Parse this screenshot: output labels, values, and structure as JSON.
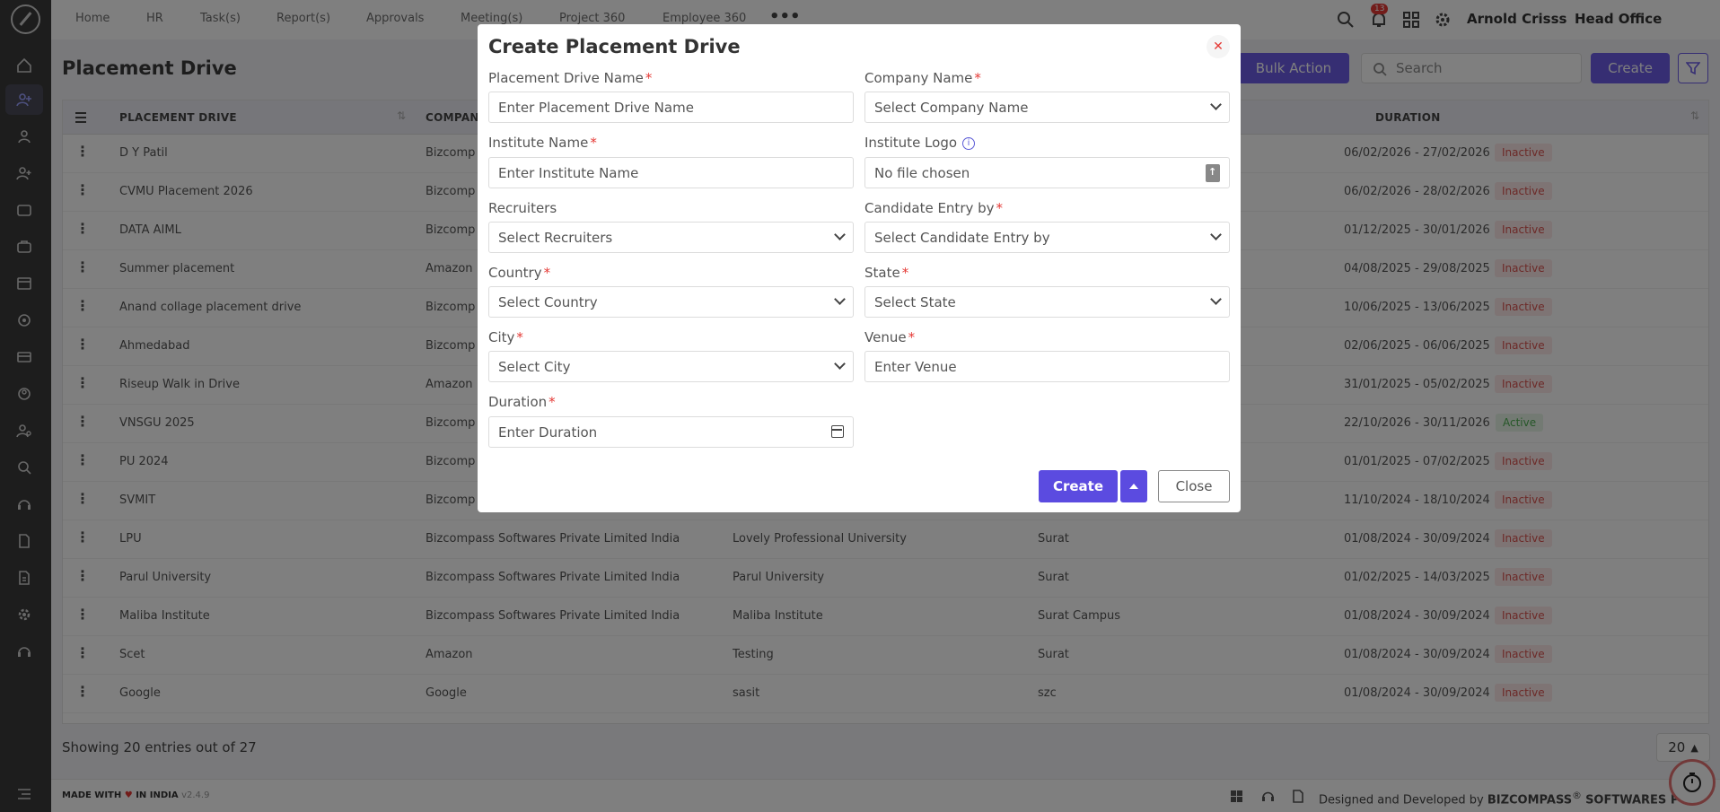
{
  "nav": {
    "items": [
      "Home",
      "HR",
      "Task(s)",
      "Report(s)",
      "Approvals",
      "Meeting(s)",
      "Project 360",
      "Employee 360"
    ],
    "notification_count": "13",
    "user_name": "Arnold Crisss",
    "office": "Head Office"
  },
  "page": {
    "title": "Placement Drive",
    "bulk_action": "Bulk Action",
    "search_placeholder": "Search",
    "create_label": "Create"
  },
  "table": {
    "headers": [
      "PLACEMENT DRIVE",
      "COMPAN",
      "DURATION"
    ],
    "rows": [
      {
        "name": "D Y Patil",
        "company": "Bizcomp",
        "institute": "",
        "venue": "",
        "duration": "06/02/2026 - 27/02/2026",
        "status": "Inactive"
      },
      {
        "name": "CVMU Placement 2026",
        "company": "Bizcomp",
        "institute": "",
        "venue": "",
        "duration": "06/02/2026 - 28/02/2026",
        "status": "Inactive"
      },
      {
        "name": "DATA AIML",
        "company": "Bizcomp",
        "institute": "",
        "venue": "",
        "duration": "01/12/2025 - 30/01/2026",
        "status": "Inactive"
      },
      {
        "name": "Summer placement",
        "company": "Amazon",
        "institute": "",
        "venue": "",
        "duration": "04/08/2025 - 29/08/2025",
        "status": "Inactive"
      },
      {
        "name": "Anand collage placement drive",
        "company": "Bizcomp",
        "institute": "",
        "venue": "",
        "duration": "10/06/2025 - 13/06/2025",
        "status": "Inactive"
      },
      {
        "name": "Ahmedabad",
        "company": "Bizcomp",
        "institute": "",
        "venue": "",
        "duration": "02/06/2025 - 06/06/2025",
        "status": "Inactive"
      },
      {
        "name": "Riseup Walk in Drive",
        "company": "Amazon",
        "institute": "",
        "venue": "",
        "duration": "31/01/2025 - 05/02/2025",
        "status": "Inactive"
      },
      {
        "name": "VNSGU 2025",
        "company": "Bizcomp",
        "institute": "",
        "venue": "",
        "duration": "22/10/2026 - 30/11/2026",
        "status": "Active"
      },
      {
        "name": "PU 2024",
        "company": "Bizcomp",
        "institute": "",
        "venue": "",
        "duration": "01/01/2025 - 07/02/2025",
        "status": "Inactive"
      },
      {
        "name": "SVMIT",
        "company": "Bizcomp",
        "institute": "",
        "venue": "",
        "duration": "11/10/2024 - 18/10/2024",
        "status": "Inactive"
      },
      {
        "name": "LPU",
        "company": "Bizcompass Softwares Private Limited India",
        "institute": "Lovely Professional University",
        "venue": "Surat",
        "duration": "01/08/2024 - 30/09/2024",
        "status": "Inactive"
      },
      {
        "name": "Parul University",
        "company": "Bizcompass Softwares Private Limited India",
        "institute": "Parul University",
        "venue": "Surat",
        "duration": "01/02/2025 - 14/03/2025",
        "status": "Inactive"
      },
      {
        "name": "Maliba Institute",
        "company": "Bizcompass Softwares Private Limited India",
        "institute": "Maliba Institute",
        "venue": "Surat Campus",
        "duration": "01/08/2024 - 30/09/2024",
        "status": "Inactive"
      },
      {
        "name": "Scet",
        "company": "Amazon",
        "institute": "Testing",
        "venue": "Surat",
        "duration": "01/08/2024 - 30/09/2024",
        "status": "Inactive"
      },
      {
        "name": "Google",
        "company": "Google",
        "institute": "sasit",
        "venue": "szc",
        "duration": "01/08/2024 - 30/09/2024",
        "status": "Inactive"
      }
    ]
  },
  "pagination": {
    "showing": "Showing 20 entries out of 27",
    "page_size": "20"
  },
  "footer": {
    "made_with": "MADE WITH",
    "in_india": "IN INDIA",
    "version": "v2.4.9",
    "designed": "Designed and Developed by",
    "company": "BIZCOMPASS",
    "company_suffix": "SOFTWARES PV"
  },
  "modal": {
    "title": "Create Placement Drive",
    "fields": {
      "drive_name_label": "Placement Drive Name",
      "drive_name_placeholder": "Enter Placement Drive Name",
      "company_label": "Company Name",
      "company_value": "Select Company Name",
      "institute_label": "Institute Name",
      "institute_placeholder": "Enter Institute Name",
      "logo_label": "Institute Logo",
      "logo_value": "No file chosen",
      "recruiters_label": "Recruiters",
      "recruiters_value": "Select Recruiters",
      "candidate_label": "Candidate Entry by",
      "candidate_value": "Select Candidate Entry by",
      "country_label": "Country",
      "country_value": "Select Country",
      "state_label": "State",
      "state_value": "Select State",
      "city_label": "City",
      "city_value": "Select City",
      "venue_label": "Venue",
      "venue_placeholder": "Enter Venue",
      "duration_label": "Duration",
      "duration_placeholder": "Enter Duration"
    },
    "create_label": "Create",
    "close_label": "Close"
  }
}
